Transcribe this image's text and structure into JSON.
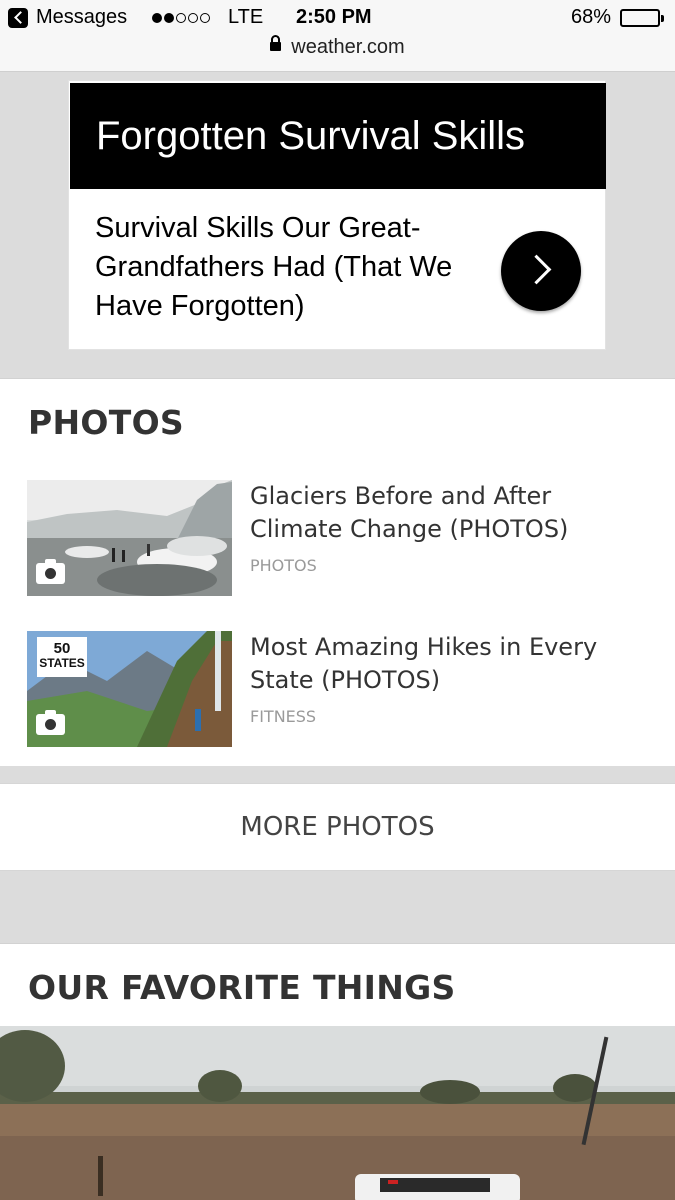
{
  "status_bar": {
    "back_label": "Messages",
    "carrier": "LTE",
    "time": "2:50 PM",
    "battery": "68%",
    "battery_level": 0.68,
    "signal_bars": 2,
    "url": "weather.com"
  },
  "ad": {
    "title": "Forgotten Survival Skills",
    "body": "Survival Skills Our Great-Grandfathers Had (That We Have Forgotten)"
  },
  "photos": {
    "heading": "PHOTOS",
    "items": [
      {
        "title": "Glaciers Before and After Climate Change (PHOTOS)",
        "category": "PHOTOS"
      },
      {
        "title": "Most Amazing Hikes in Every State (PHOTOS)",
        "category": "FITNESS",
        "badge_top": "50",
        "badge_bottom": "STATES"
      }
    ],
    "more_label": "MORE PHOTOS"
  },
  "favorites": {
    "heading": "OUR FAVORITE THINGS"
  }
}
